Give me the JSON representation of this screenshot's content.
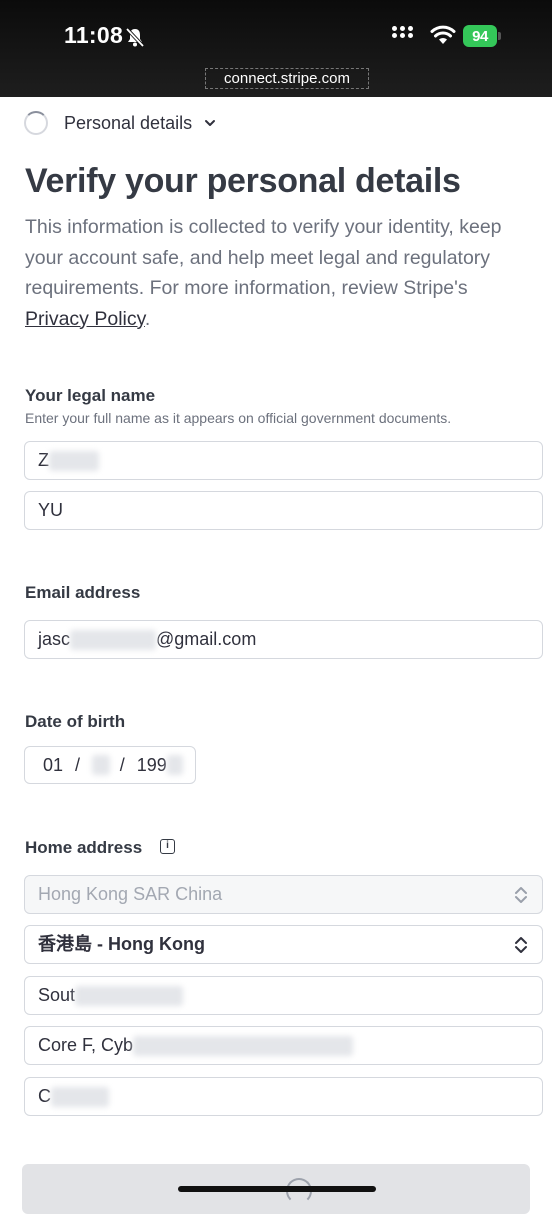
{
  "status_bar": {
    "time": "11:08",
    "battery": "94"
  },
  "url_bar": {
    "domain": "connect.stripe.com"
  },
  "step": {
    "label": "Personal details"
  },
  "header": {
    "title": "Verify your personal details",
    "intro": "This information is collected to verify your identity, keep your account safe, and help meet legal and regulatory requirements. For more information, review Stripe's",
    "privacy_link": "Privacy Policy",
    "period": "."
  },
  "legal_name": {
    "label": "Your legal name",
    "hint": "Enter your full name as it appears on official government documents.",
    "first_name_value": "Z",
    "last_name_value": "YU"
  },
  "email": {
    "label": "Email address",
    "value_prefix": "jasc",
    "value_suffix": "@gmail.com"
  },
  "dob": {
    "label": "Date of birth",
    "day": "01",
    "sep1": "/",
    "sep2": "/",
    "year": "199"
  },
  "home_address": {
    "label": "Home address",
    "info_glyph": "i",
    "country": "Hong Kong SAR China",
    "region": "香港島 - Hong Kong",
    "line1": "Sout",
    "line2": "Core F, Cyb",
    "line3": "C"
  },
  "colors": {
    "accent": "#635bff",
    "text": "#30313d",
    "muted": "#6c717d",
    "border": "#d5d8de"
  }
}
